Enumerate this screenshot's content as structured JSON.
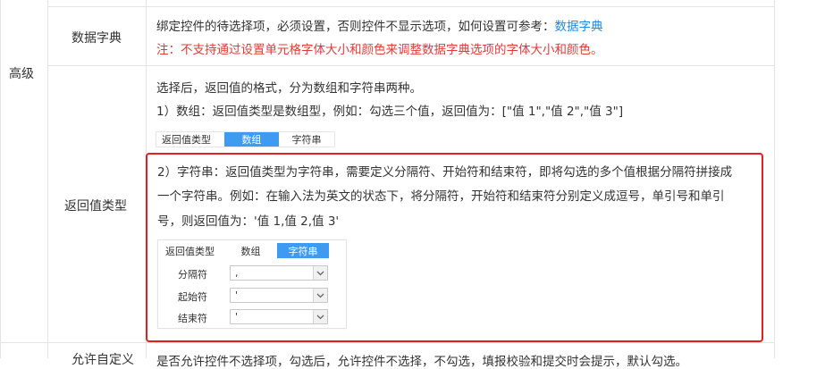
{
  "section": {
    "label": "高级"
  },
  "rows": {
    "data_dict": {
      "label": "数据字典",
      "line1_prefix": "绑定控件的待选择项，必须设置，否则控件不显示选项，如何设置可参考：",
      "line1_link": "数据字典",
      "line2": "注：不支持通过设置单元格字体大小和颜色来调整数据字典选项的字体大小和颜色。"
    },
    "return_type": {
      "label": "返回值类型",
      "intro": "选择后，返回值的格式，分为数组和字符串两种。",
      "array_desc": "1）数组：返回值类型是数组型，例如：勾选三个值，返回值为：[\"值 1\",\"值 2\",\"值 3\"]",
      "widget1": {
        "label": "返回值类型",
        "opt_array": "数组",
        "opt_string": "字符串",
        "selected": "数组"
      },
      "string_desc_line1": "2）字符串：返回值类型为字符串，需要定义分隔符、开始符和结束符，即将勾选的多个值根据分隔符拼接成",
      "string_desc_line2": "一个字符串。例如：在输入法为英文的状态下，将分隔符，开始符和结束符分别定义成逗号，单引号和单引",
      "string_desc_line3": "号，则返回值为：'值 1,值 2,值 3'",
      "widget2": {
        "label": "返回值类型",
        "opt_array": "数组",
        "opt_string": "字符串",
        "selected": "字符串",
        "separator_label": "分隔符",
        "separator_value": ",",
        "start_label": "起始符",
        "start_value": "'",
        "end_label": "结束符",
        "end_value": "'"
      }
    },
    "next": {
      "label": "允许自定义",
      "desc": "是否允许控件不选择项，勾选后，允许控件不选择，不勾选，填报校验和提交时会提示，默认勾选。"
    }
  },
  "colors": {
    "accent": "#3f9bf1",
    "note": "#e03a3a",
    "link": "#1e88e5",
    "highlight_border": "#e02020"
  },
  "icons": {
    "dropdown": "chevron-down-icon"
  }
}
